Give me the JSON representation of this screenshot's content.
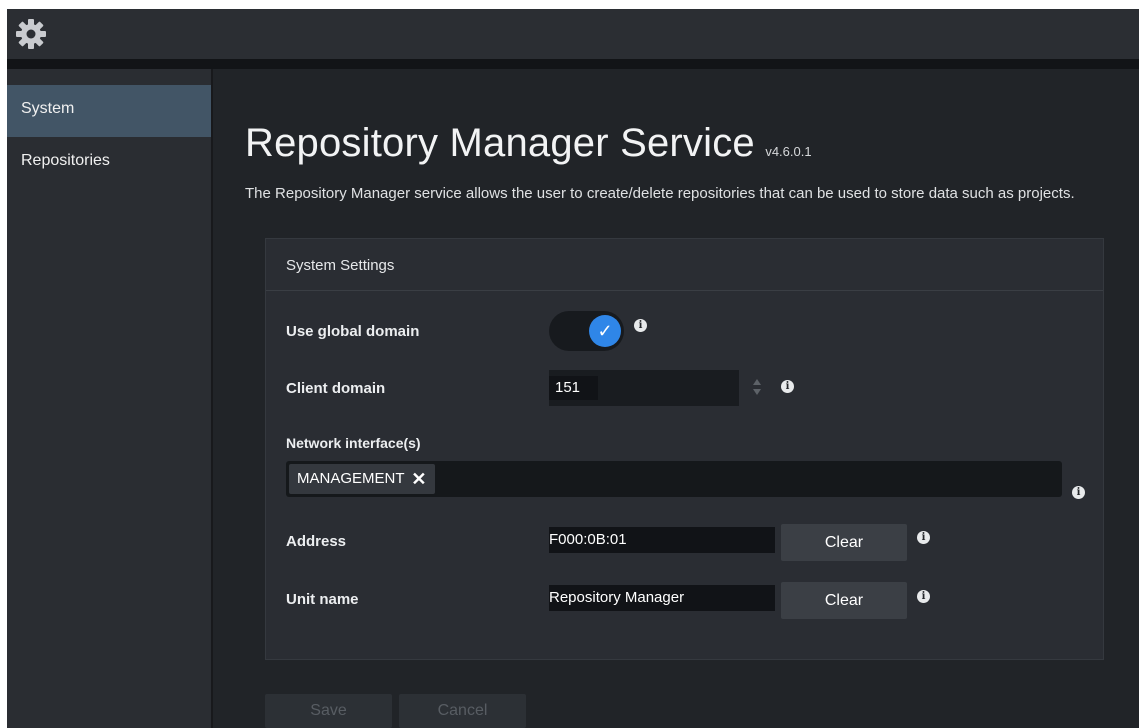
{
  "topbar": {
    "icon": "gear-icon"
  },
  "sidebar": {
    "items": [
      {
        "label": "System",
        "active": true
      },
      {
        "label": "Repositories",
        "active": false
      }
    ]
  },
  "page": {
    "title": "Repository Manager Service",
    "version": "v4.6.0.1",
    "description": "The Repository Manager service allows the user to create/delete repositories that can be used to store data such as projects."
  },
  "settings": {
    "title": "System Settings",
    "use_global_domain": {
      "label": "Use global domain",
      "checked": true
    },
    "client_domain": {
      "label": "Client domain",
      "value": "151"
    },
    "network_interfaces": {
      "label": "Network interface(s)",
      "tags": [
        "MANAGEMENT"
      ],
      "remove_glyph": "✕"
    },
    "address": {
      "label": "Address",
      "value": "F000:0B:01",
      "clear_label": "Clear"
    },
    "unit_name": {
      "label": "Unit name",
      "value": "Repository Manager",
      "clear_label": "Clear"
    }
  },
  "actions": {
    "save_label": "Save",
    "cancel_label": "Cancel"
  },
  "colors": {
    "accent": "#2f86e8",
    "sidebar_active": "#425566",
    "background": "#212428"
  }
}
